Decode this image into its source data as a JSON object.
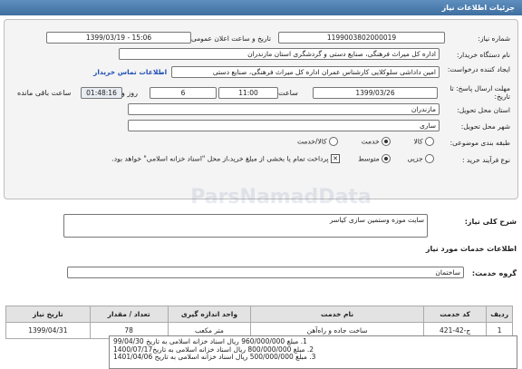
{
  "page": {
    "title": "جزئیات اطلاعات نیاز"
  },
  "form": {
    "need_number": {
      "label": "شماره نیاز:",
      "value": "1199003802000019"
    },
    "announce_datetime": {
      "label": "تاریخ و ساعت اعلان عمومی:",
      "value": "1399/03/19 - 15:06"
    },
    "buyer_org": {
      "label": "نام دستگاه خریدار:",
      "value": "اداره کل میراث فرهنگی، صنایع دستی و گردشگری استان مازندران"
    },
    "requester": {
      "label": "ایجاد کننده درخواست:",
      "value": "امین داداشی سلوکلایی کارشناس عمران اداره کل میراث فرهنگی، صنایع دستی",
      "contact_link": "اطلاعات تماس خریدار"
    },
    "deadline": {
      "label": "مهلت ارسال پاسخ: تا تاریخ:",
      "date": "1399/03/26",
      "time_label": "ساعت",
      "time": "11:00",
      "days": "6",
      "days_label": "روز و",
      "remaining": "01:48:16",
      "remaining_label": "ساعت باقی مانده"
    },
    "province": {
      "label": "استان محل تحویل:",
      "value": "مازندران"
    },
    "city": {
      "label": "شهر محل تحویل:",
      "value": "ساری"
    },
    "category": {
      "label": "طبقه بندی موضوعی:",
      "options": [
        {
          "label": "کالا",
          "selected": false
        },
        {
          "label": "خدمت",
          "selected": true
        },
        {
          "label": "کالا/خدمت",
          "selected": false
        }
      ]
    },
    "process_type": {
      "label": "نوع فرآیند خرید :",
      "options": [
        {
          "label": "جزیی",
          "selected": false
        },
        {
          "label": "متوسط",
          "selected": true
        }
      ],
      "payment_note": "پرداخت تمام یا بخشی از مبلغ خرید،از محل \"اسناد خزانه اسلامی\" خواهد بود."
    }
  },
  "description": {
    "label": "شرح کلی نیاز:",
    "value": "سایت موزه وستمین سازی کیاسر"
  },
  "services_heading": "اطلاعات خدمات مورد نیاز",
  "service_group": {
    "label": "گروه خدمت:",
    "value": "ساختمان"
  },
  "table": {
    "headers": [
      "ردیف",
      "کد خدمت",
      "نام خدمت",
      "واحد اندازه گیری",
      "تعداد / مقدار",
      "تاریخ نیاز"
    ],
    "rows": [
      [
        "1",
        "ج-42-421",
        "ساخت جاده و راه‌آهن",
        "متر مکعب",
        "78",
        "1399/04/31"
      ]
    ]
  },
  "notes": [
    "1. مبلغ 960/000/000 ریال اسناد خزانه اسلامی به تاریخ 99/04/30",
    "2. مبلغ 800/000/000 ریال اسناد خزانه اسلامی به تاریخ1400/07/17",
    "3. مبلغ 500/000/000 ریال اسناد خزانه اسلامی به تاریخ 1401/04/06"
  ],
  "watermark": "ParsNamadData"
}
